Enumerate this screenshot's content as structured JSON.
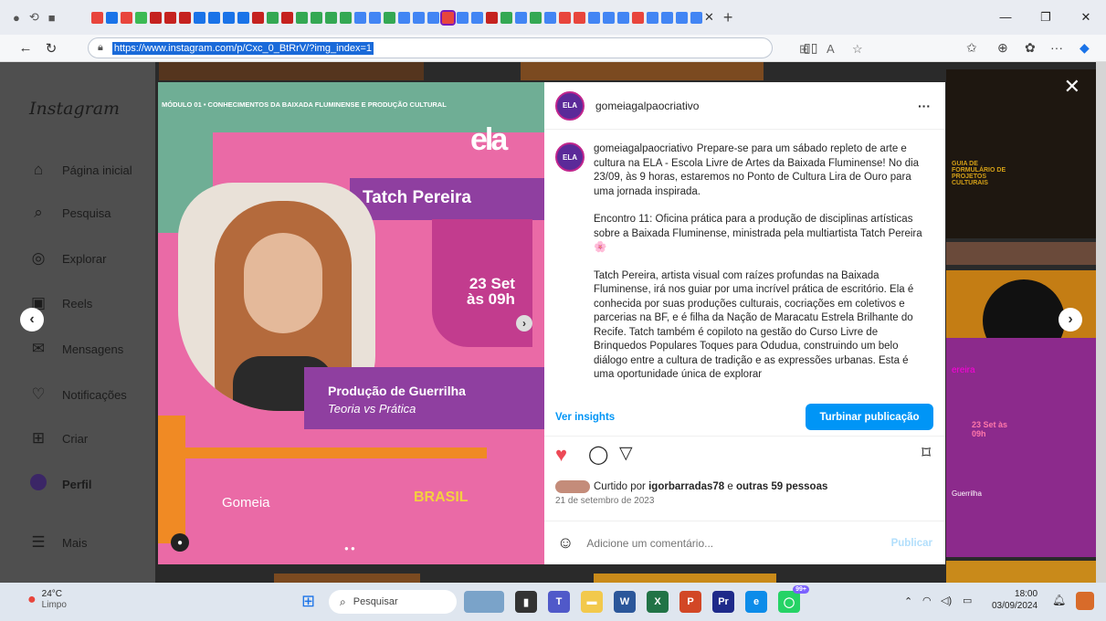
{
  "browser": {
    "url": "https://www.instagram.com/p/Cxc_0_BtRrV/?img_index=1",
    "tab_colors": [
      "#e8453c",
      "#1a73e8",
      "#e8453c",
      "#3cba54",
      "#c5221f",
      "#c5221f",
      "#c5221f",
      "#1a73e8",
      "#1a73e8",
      "#1a73e8",
      "#1a73e8",
      "#c5221f",
      "#34a853",
      "#c5221f",
      "#34a853",
      "#34a853",
      "#34a853",
      "#34a853",
      "#4285f4",
      "#4285f4",
      "#34a853",
      "#4285f4",
      "#4285f4",
      "#4285f4",
      "#e8453c",
      "#4285f4",
      "#4285f4",
      "#c5221f",
      "#34a853",
      "#4285f4",
      "#34a853",
      "#4285f4",
      "#e8453c",
      "#e8453c",
      "#4285f4",
      "#4285f4",
      "#4285f4",
      "#e8453c",
      "#4285f4",
      "#4285f4",
      "#4285f4",
      "#4285f4"
    ]
  },
  "sidebar": {
    "logo": "Instagram",
    "items": [
      {
        "icon": "home-icon",
        "label": "Página inicial"
      },
      {
        "icon": "search-icon",
        "label": "Pesquisa"
      },
      {
        "icon": "explore-icon",
        "label": "Explorar"
      },
      {
        "icon": "reels-icon",
        "label": "Reels"
      },
      {
        "icon": "messages-icon",
        "label": "Mensagens"
      },
      {
        "icon": "heart-icon",
        "label": "Notificações"
      },
      {
        "icon": "plus-square-icon",
        "label": "Criar"
      },
      {
        "icon": "avatar",
        "label": "Perfil"
      },
      {
        "icon": "menu-icon",
        "label": "Mais"
      }
    ]
  },
  "post_image": {
    "header": "MÓDULO 01 • CONHECIMENTOS DA BAIXADA FLUMINENSE E PRODUÇÃO CULTURAL",
    "name": "Tatch Pereira",
    "date_line1": "23 Set",
    "date_line2": "às 09h",
    "title": "Produção de Guerrilha",
    "subtitle": "Teoria vs Prática",
    "footer_logo": "Gomeia",
    "footer_logo_mark": "ela",
    "brasil": "BRASIL"
  },
  "post": {
    "username": "gomeiagalpaocriativo",
    "caption_p1": "Prepare-se para um sábado repleto de arte e cultura na ELA - Escola Livre de Artes da Baixada Fluminense! No dia 23/09, às 9 horas, estaremos no Ponto de Cultura Lira de Ouro para uma jornada inspirada.",
    "caption_p2": "Encontro 11: Oficina prática para a produção de disciplinas artísticas sobre a Baixada Fluminense, ministrada pela multiartista Tatch Pereira 🌸",
    "caption_p3": "Tatch Pereira, artista visual com raízes profundas na Baixada Fluminense, irá nos guiar por uma incrível prática de escritório. Ela é conhecida por suas produções culturais, cocriações em coletivos e parcerias na BF, e é filha da Nação de Maracatu Estrela Brilhante do Recife. Tatch também é copiloto na gestão do Curso Livre de Brinquedos Populares Toques para Odudua, construindo um belo diálogo entre a cultura de tradição e as expressões urbanas. Esta é uma oportunidade única de explorar",
    "view_insights": "Ver insights",
    "boost": "Turbinar publicação",
    "likes_prefix": "Curtido por ",
    "likes_user": "igorbarradas78",
    "likes_mid": " e ",
    "likes_others": "outras 59 pessoas",
    "date": "21 de setembro de 2023",
    "comment_placeholder": "Adicione um comentário...",
    "publish": "Publicar"
  },
  "bg_tiles": {
    "label1": "GUIA DE FORMULÁRIO DE PROJETOS CULTURAIS",
    "label2": "ereira",
    "label3": "23 Set às 09h",
    "label4": "Guerrilha"
  },
  "taskbar": {
    "weather_temp": "24°C",
    "weather_desc": "Limpo",
    "search": "Pesquisar",
    "time": "18:00",
    "date": "03/09/2024",
    "badge": "99+"
  },
  "colors": {
    "accent_blue": "#0095f6",
    "heart_red": "#ed4956",
    "post_pink": "#ea6aa6",
    "post_purple": "#8f3fa0"
  }
}
